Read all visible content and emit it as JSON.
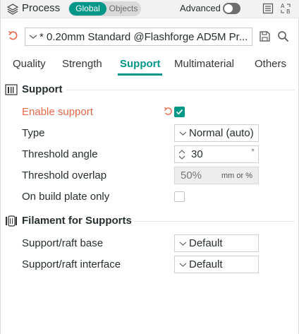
{
  "header": {
    "title": "Process",
    "mode_global": "Global",
    "mode_objects": "Objects",
    "advanced_label": "Advanced",
    "advanced_enabled": false,
    "icons": [
      "layers-icon",
      "compare-icon",
      "sort-ab-icon"
    ]
  },
  "preset": {
    "name": "* 0.20mm Standard @Flashforge AD5M Pr..."
  },
  "tabs": [
    {
      "label": "Quality",
      "active": false
    },
    {
      "label": "Strength",
      "active": false
    },
    {
      "label": "Support",
      "active": true
    },
    {
      "label": "Multimaterial",
      "active": false
    },
    {
      "label": "Others",
      "active": false
    }
  ],
  "sections": {
    "support": {
      "title": "Support",
      "options": {
        "enable_support": {
          "label": "Enable support",
          "checked": true,
          "modified": true
        },
        "type": {
          "label": "Type",
          "value": "Normal (auto)"
        },
        "threshold_angle": {
          "label": "Threshold angle",
          "value": "30",
          "unit": "°"
        },
        "threshold_overlap": {
          "label": "Threshold overlap",
          "value": "50%",
          "unit": "mm or %"
        },
        "on_build_plate_only": {
          "label": "On build plate only",
          "checked": false
        }
      }
    },
    "filament": {
      "title": "Filament for Supports",
      "options": {
        "raft_base": {
          "label": "Support/raft base",
          "value": "Default"
        },
        "raft_interface": {
          "label": "Support/raft interface",
          "value": "Default"
        }
      }
    }
  },
  "colors": {
    "accent": "#009688",
    "modified": "#e8694a",
    "text": "#262e30"
  }
}
